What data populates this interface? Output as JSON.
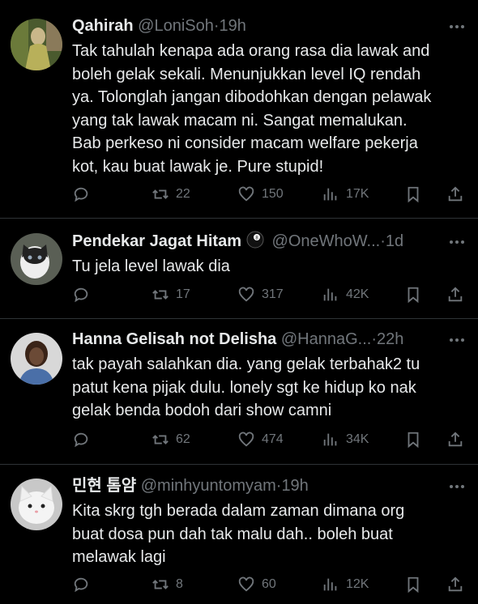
{
  "tweets": [
    {
      "name": "Qahirah",
      "handle": "@LoniSoh",
      "sep": "·",
      "time": "19h",
      "text": "Tak tahulah kenapa ada orang rasa dia lawak and\nboleh gelak sekali. Menunjukkan level IQ rendah\nya. Tolonglah jangan dibodohkan dengan pelawak\nyang tak lawak macam ni. Sangat memalukan.\nBab perkeso ni consider macam welfare pekerja\nkot, kau buat lawak je. Pure stupid!",
      "reposts": "22",
      "likes": "150",
      "views": "17K"
    },
    {
      "name": "Pendekar Jagat Hitam",
      "badge_icon": "8-ball-emoji",
      "handle": "@OneWhoW...",
      "sep": "·",
      "time": "1d",
      "text": "Tu jela level lawak dia",
      "reposts": "17",
      "likes": "317",
      "views": "42K"
    },
    {
      "name": "Hanna Gelisah not Delisha",
      "handle": "@HannaG...",
      "sep": "·",
      "time": "22h",
      "text": "tak payah salahkan dia. yang gelak terbahak2 tu\npatut kena pijak dulu. lonely sgt ke hidup ko nak\ngelak benda bodoh dari show camni",
      "reposts": "62",
      "likes": "474",
      "views": "34K"
    },
    {
      "name": "민현 톰얌",
      "handle": "@minhyuntomyam",
      "sep": "·",
      "time": "19h",
      "text": "Kita skrg tgh berada dalam zaman dimana org\nbuat dosa pun dah tak malu dah.. boleh buat\nmelawak lagi",
      "reposts": "8",
      "likes": "60",
      "views": "12K"
    }
  ],
  "icons": [
    "reply-icon",
    "repost-icon",
    "like-icon",
    "views-icon",
    "bookmark-icon",
    "share-icon",
    "more-icon"
  ],
  "colors": {
    "background": "#000000",
    "text": "#e7e9ea",
    "muted": "#71767b",
    "divider": "#2f3336"
  }
}
